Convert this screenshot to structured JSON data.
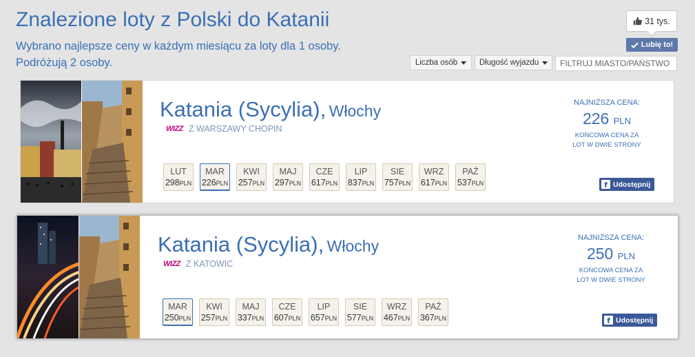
{
  "header": {
    "title": "Znalezione loty z Polski do Katanii",
    "subtitle_line1": "Wybrano najlepsze ceny w każdym miesiącu za loty dla 1 osoby.",
    "subtitle_line2": "Podróżują 2 osoby."
  },
  "social": {
    "like_count": "31 tys.",
    "like_button": "Lubię to!",
    "like_icon": "thumbs-up-icon",
    "check_icon": "check-icon"
  },
  "filters": {
    "persons_label": "Liczba osób",
    "duration_label": "Długość wyjazdu",
    "city_placeholder": "FILTRUJ MIASTO/PAŃSTWO"
  },
  "currency": "PLN",
  "results": [
    {
      "city": "Katania (Sycylia),",
      "country": "Włochy",
      "airline_logo": "WIZZ",
      "from": "Z WARSZAWY CHOPIN",
      "lowest_label": "NAJNIŻSZA CENA:",
      "lowest_price": "226",
      "price_note_1": "KOŃCOWA CENA ZA",
      "price_note_2": "LOT W DWIE STRONY",
      "share_label": "Udostępnij",
      "selected_month": "MAR",
      "months": [
        {
          "m": "LUT",
          "p": "298"
        },
        {
          "m": "MAR",
          "p": "226"
        },
        {
          "m": "KWI",
          "p": "257"
        },
        {
          "m": "MAJ",
          "p": "297"
        },
        {
          "m": "CZE",
          "p": "617"
        },
        {
          "m": "LIP",
          "p": "837"
        },
        {
          "m": "SIE",
          "p": "757"
        },
        {
          "m": "WRZ",
          "p": "617"
        },
        {
          "m": "PAŹ",
          "p": "537"
        }
      ]
    },
    {
      "city": "Katania (Sycylia),",
      "country": "Włochy",
      "airline_logo": "WIZZ",
      "from": "Z KATOWIC",
      "lowest_label": "NAJNIŻSZA CENA:",
      "lowest_price": "250",
      "price_note_1": "KOŃCOWA CENA ZA",
      "price_note_2": "LOT W DWIE STRONY",
      "share_label": "Udostępnij",
      "selected_month": "MAR",
      "months": [
        {
          "m": "MAR",
          "p": "250"
        },
        {
          "m": "KWI",
          "p": "257"
        },
        {
          "m": "MAJ",
          "p": "337"
        },
        {
          "m": "CZE",
          "p": "607"
        },
        {
          "m": "LIP",
          "p": "657"
        },
        {
          "m": "SIE",
          "p": "577"
        },
        {
          "m": "WRZ",
          "p": "467"
        },
        {
          "m": "PAŹ",
          "p": "367"
        }
      ]
    }
  ]
}
